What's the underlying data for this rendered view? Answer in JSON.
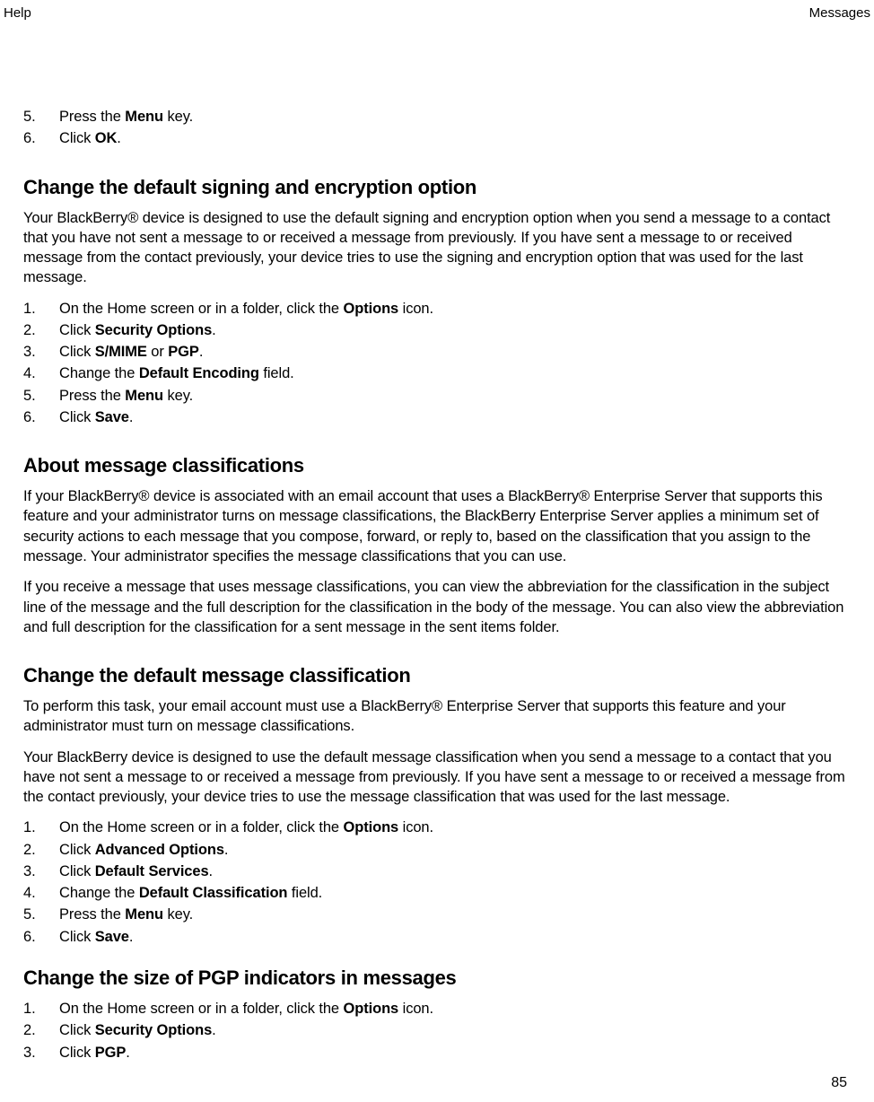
{
  "header": {
    "left": "Help",
    "right": "Messages"
  },
  "footer": {
    "page_number": "85"
  },
  "pre_steps": [
    {
      "pre": "Press the ",
      "b1": "Menu",
      "post": " key."
    },
    {
      "pre": "Click ",
      "b1": "OK",
      "post": "."
    }
  ],
  "sec1": {
    "title": "Change the default signing and encryption option",
    "intro": "Your BlackBerry® device is designed to use the default signing and encryption option when you send a message to a contact that you have not sent a message to or received a message from previously. If you have sent a message to or received message from the contact previously, your device tries to use the signing and encryption option that was used for the last message.",
    "steps": [
      {
        "pre": "On the Home screen or in a folder, click the ",
        "b1": "Options",
        "post": " icon."
      },
      {
        "pre": "Click ",
        "b1": "Security Options",
        "post": "."
      },
      {
        "pre": "Click ",
        "b1": "S/MIME",
        "mid": " or ",
        "b2": "PGP",
        "post": "."
      },
      {
        "pre": "Change the ",
        "b1": "Default Encoding",
        "post": " field."
      },
      {
        "pre": "Press the ",
        "b1": "Menu",
        "post": " key."
      },
      {
        "pre": "Click ",
        "b1": "Save",
        "post": "."
      }
    ]
  },
  "sec2": {
    "title": "About message classifications",
    "para1": "If your BlackBerry® device is associated with an email account that uses a BlackBerry® Enterprise Server that supports this feature and your administrator turns on message classifications, the BlackBerry Enterprise Server applies a minimum set of security actions to each message that you compose, forward, or reply to, based on the classification that you assign to the message. Your administrator specifies the message classifications that you can use.",
    "para2": "If you receive a message that uses message classifications, you can view the abbreviation for the classification in the subject line of the message and the full description for the classification in the body of the message. You can also view the abbreviation and full description for the classification for a sent message in the sent items folder."
  },
  "sec3": {
    "title": "Change the default message classification",
    "para1": "To perform this task, your email account must use a BlackBerry® Enterprise Server that supports this feature and your administrator must turn on message classifications.",
    "para2": "Your BlackBerry device is designed to use the default message classification when you send a message to a contact that you have not sent a message to or received a message from previously. If you have sent a message to or received a message from the contact previously, your device tries to use the message classification that was used for the last message.",
    "steps": [
      {
        "pre": "On the Home screen or in a folder, click the ",
        "b1": "Options",
        "post": " icon."
      },
      {
        "pre": "Click ",
        "b1": "Advanced Options",
        "post": "."
      },
      {
        "pre": "Click ",
        "b1": "Default Services",
        "post": "."
      },
      {
        "pre": "Change the ",
        "b1": "Default Classification",
        "post": " field."
      },
      {
        "pre": "Press the ",
        "b1": "Menu",
        "post": " key."
      },
      {
        "pre": "Click ",
        "b1": "Save",
        "post": "."
      }
    ]
  },
  "sec4": {
    "title": "Change the size of PGP indicators in messages",
    "steps": [
      {
        "pre": "On the Home screen or in a folder, click the ",
        "b1": "Options",
        "post": " icon."
      },
      {
        "pre": "Click ",
        "b1": "Security Options",
        "post": "."
      },
      {
        "pre": "Click ",
        "b1": "PGP",
        "post": "."
      }
    ]
  }
}
